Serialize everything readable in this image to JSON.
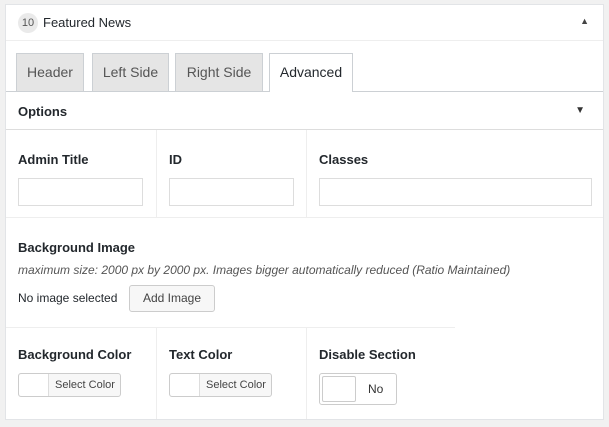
{
  "widget": {
    "number": "10",
    "title": "Featured News",
    "collapse_glyph": "▲"
  },
  "tabs": [
    {
      "label": "Header"
    },
    {
      "label": "Left Side"
    },
    {
      "label": "Right Side"
    },
    {
      "label": "Advanced",
      "active": true
    }
  ],
  "options": {
    "label": "Options",
    "toggle_glyph": "▼"
  },
  "fields": {
    "admin_title": {
      "label": "Admin Title",
      "value": ""
    },
    "id": {
      "label": "ID",
      "value": ""
    },
    "classes": {
      "label": "Classes",
      "value": ""
    }
  },
  "background_image": {
    "label": "Background Image",
    "note": "maximum size: 2000 px by 2000 px. Images bigger automatically reduced (Ratio Maintained)",
    "status": "No image selected",
    "button_label": "Add Image"
  },
  "background_color": {
    "label": "Background Color",
    "button_label": "Select Color"
  },
  "text_color": {
    "label": "Text Color",
    "button_label": "Select Color"
  },
  "disable_section": {
    "label": "Disable Section",
    "value": "No"
  }
}
